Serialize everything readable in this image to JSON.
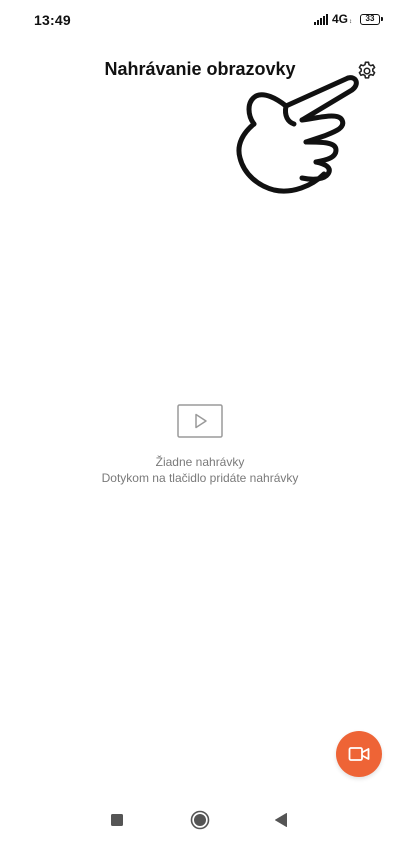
{
  "status_bar": {
    "time": "13:49",
    "network": "4G",
    "network_sub": "↕",
    "battery": "33"
  },
  "header": {
    "title": "Nahrávanie obrazovky",
    "settings_icon": "gear-icon"
  },
  "empty_state": {
    "icon": "video-play-icon",
    "title": "Žiadne nahrávky",
    "hint": "Dotykom na tlačidlo pridáte nahrávky"
  },
  "fab": {
    "icon": "video-camera-icon"
  },
  "nav": {
    "recents_icon": "square-icon",
    "home_icon": "circle-icon",
    "back_icon": "triangle-back-icon"
  },
  "colors": {
    "accent": "#ee6436",
    "secondary_text": "#7a7a7a",
    "background": "#ffffff"
  }
}
